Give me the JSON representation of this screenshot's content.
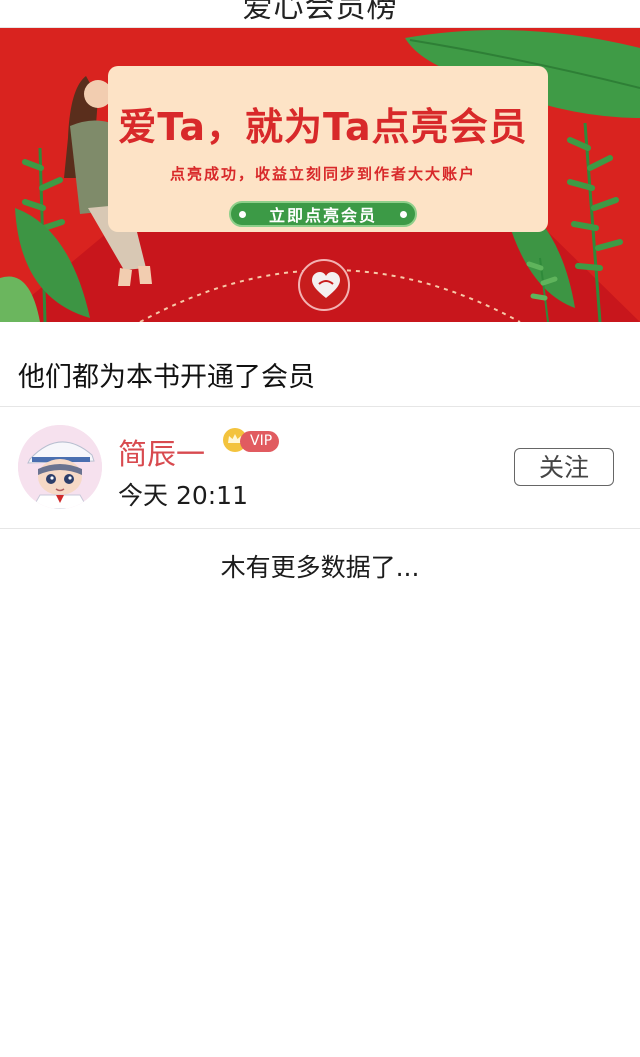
{
  "header": {
    "title": "爱心会员榜"
  },
  "banner": {
    "headline": "爱Ta，就为Ta点亮会员",
    "subline": "点亮成功，收益立刻同步到作者大大账户",
    "cta_label": "立即点亮会员"
  },
  "section": {
    "title": "他们都为本书开通了会员"
  },
  "members": [
    {
      "name": "简辰一",
      "badge": "VIP",
      "time": "今天 20:11",
      "follow_label": "关注"
    }
  ],
  "footer": {
    "no_more_text": "木有更多数据了..."
  },
  "colors": {
    "banner_red": "#d9231f",
    "card_cream": "#fde3c6",
    "cta_green": "#3c9a46",
    "name_red": "#d84a4f",
    "vip_pink": "#e15b60"
  },
  "icons": [
    "back-icon",
    "crown-icon",
    "heart-icon"
  ]
}
